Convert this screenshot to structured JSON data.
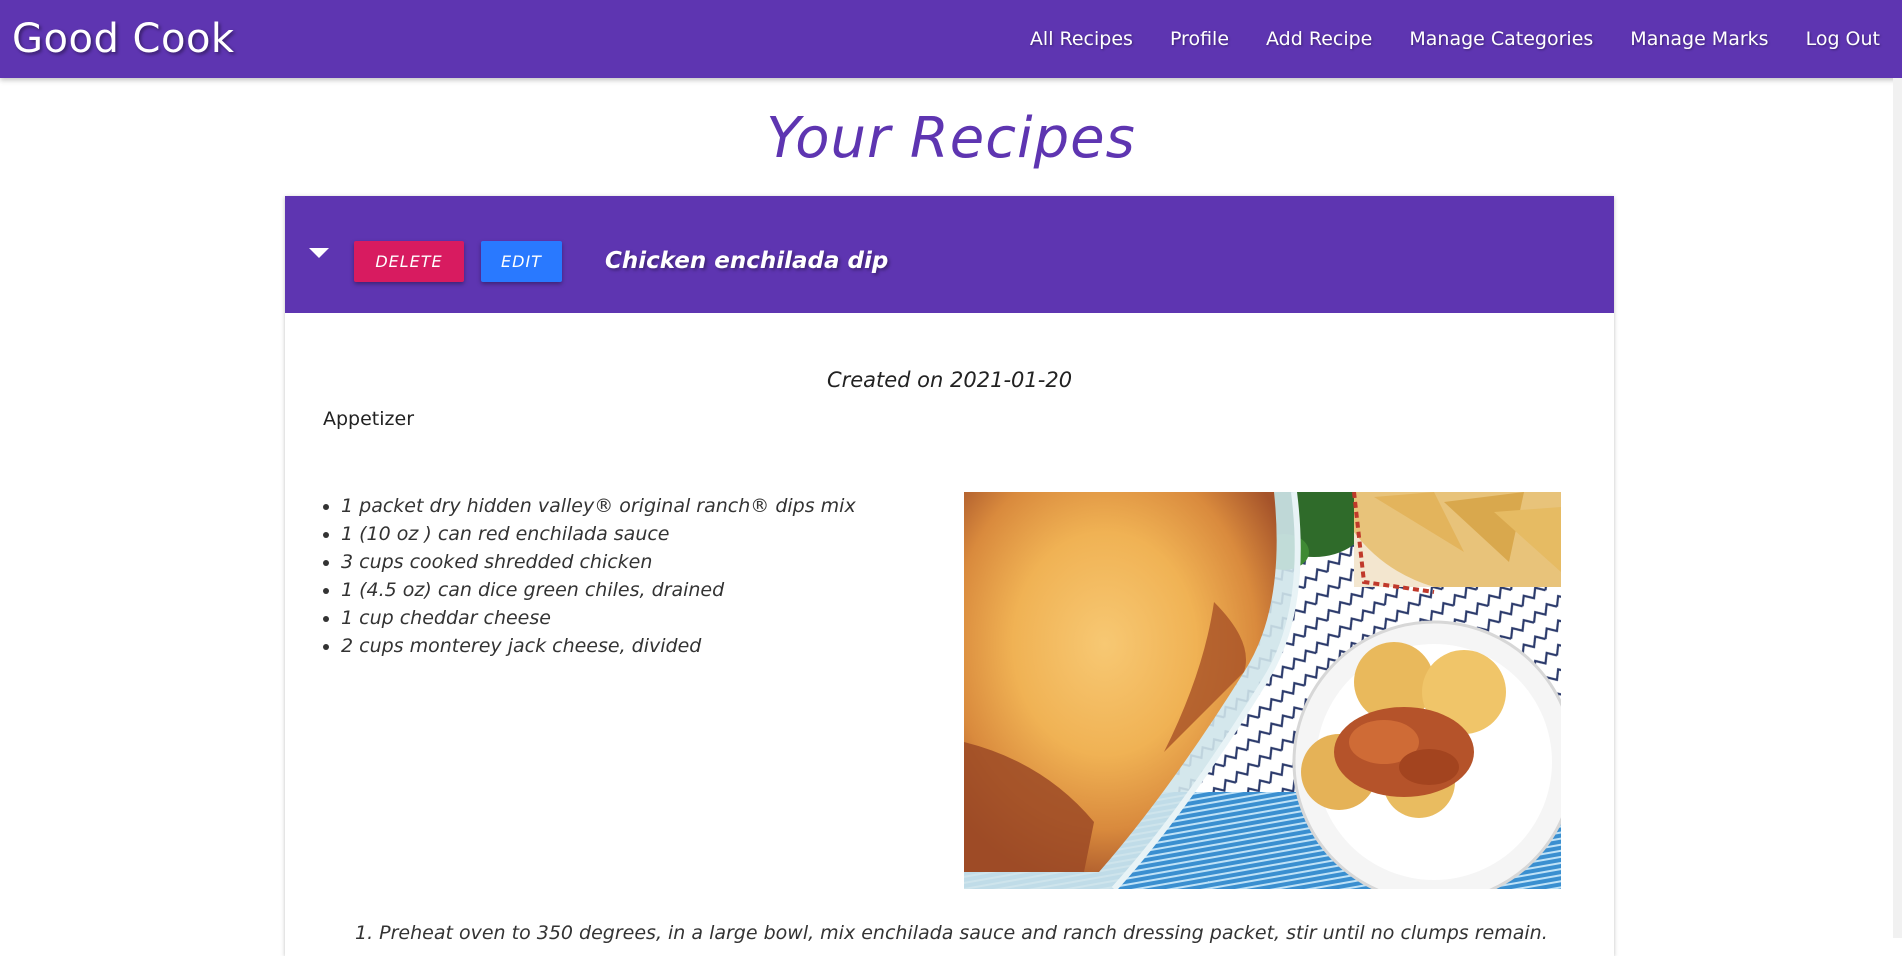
{
  "navbar": {
    "brand": "Good Cook",
    "links": [
      {
        "label": "All Recipes"
      },
      {
        "label": "Profile"
      },
      {
        "label": "Add Recipe"
      },
      {
        "label": "Manage Categories"
      },
      {
        "label": "Manage Marks"
      },
      {
        "label": "Log Out"
      }
    ]
  },
  "page": {
    "title": "Your Recipes"
  },
  "recipe": {
    "toggle_icon": "caret-down-icon",
    "delete_label": "DELETE",
    "edit_label": "EDIT",
    "name": "Chicken enchilada dip",
    "created": "Created on 2021-01-20",
    "category": "Appetizer",
    "ingredients": [
      "1 packet dry hidden valley® original ranch® dips mix",
      "1 (10 oz ) can red enchilada sauce",
      "3 cups cooked shredded chicken",
      "1 (4.5 oz) can dice green chiles, drained",
      "1 cup cheddar cheese",
      "2 cups monterey jack cheese, divided"
    ],
    "steps": [
      "1. Preheat oven to 350 degrees, in a large bowl, mix enchilada sauce and ranch dressing packet, stir until no clumps remain."
    ]
  },
  "colors": {
    "brand": "#5e35b1",
    "delete": "#d81b60",
    "edit": "#2979ff"
  }
}
